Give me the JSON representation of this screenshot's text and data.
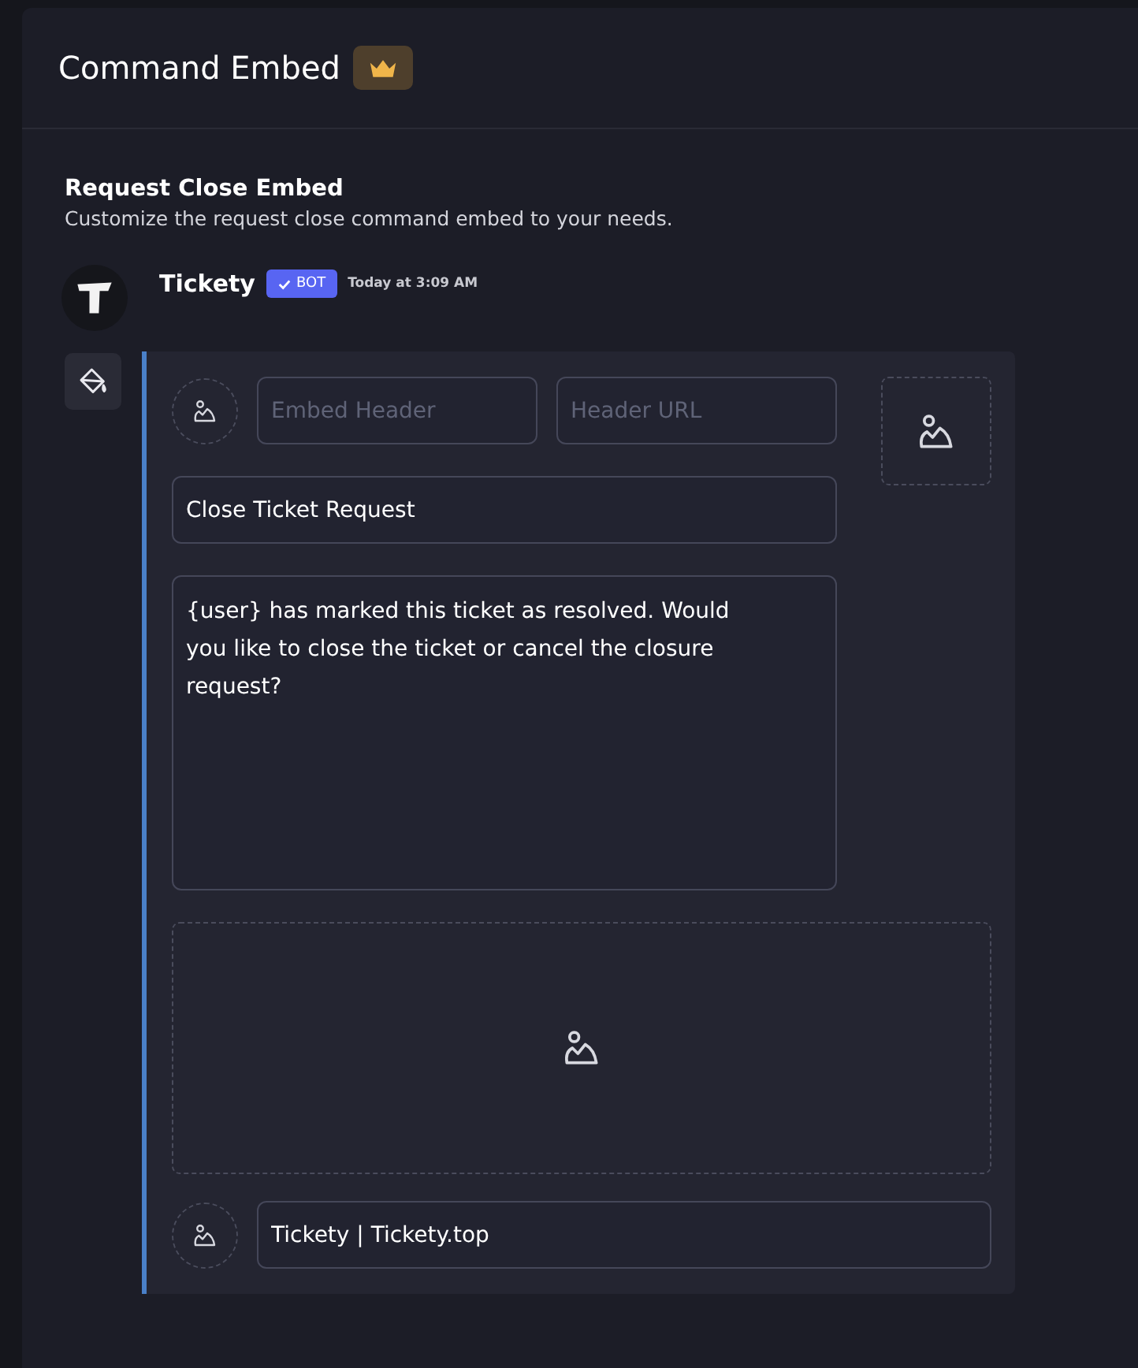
{
  "header": {
    "title": "Command Embed"
  },
  "section": {
    "title": "Request Close Embed",
    "description": "Customize the request close command embed to your needs."
  },
  "message": {
    "author": "Tickety",
    "badge": "BOT",
    "timestamp": "Today at 3:09 AM"
  },
  "embed": {
    "author_name": {
      "placeholder": "Embed Header"
    },
    "author_url": {
      "placeholder": "Header URL"
    },
    "title": {
      "value": "Close Ticket Request"
    },
    "description": {
      "value": "{user} has marked this ticket as resolved. Would you like to close the ticket or cancel the closure request?"
    },
    "footer": {
      "value": "Tickety | Tickety.top"
    }
  }
}
